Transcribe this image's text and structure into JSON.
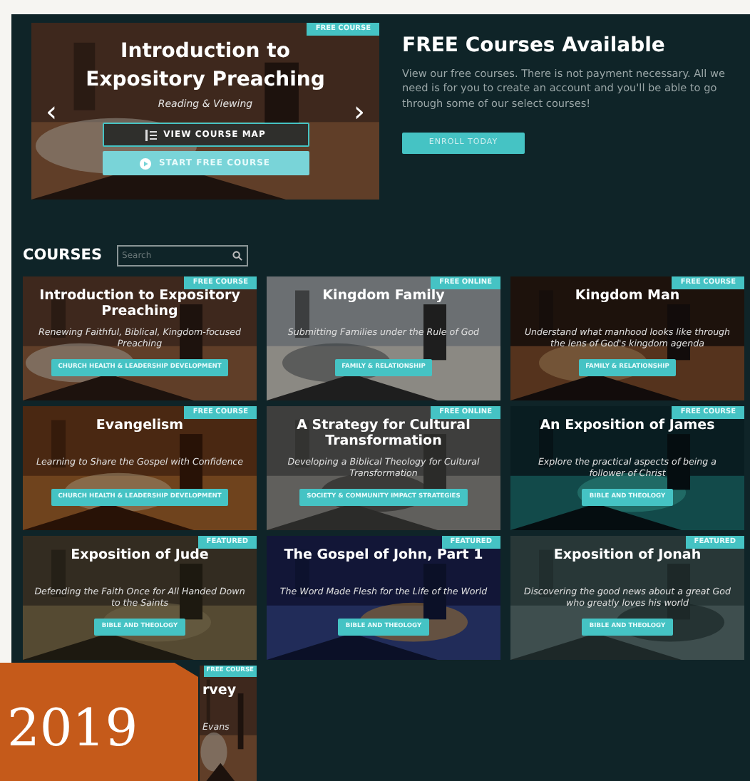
{
  "hero": {
    "badge": "FREE COURSE",
    "title": "Introduction to Expository Preaching",
    "subtitle": "Reading & Viewing",
    "prev": "‹",
    "next": "›",
    "buttons": [
      {
        "kind": "outline",
        "label": "VIEW COURSE MAP"
      },
      {
        "kind": "solid",
        "label": "START FREE COURSE"
      }
    ]
  },
  "promo": {
    "title": "FREE Courses Available",
    "text": "View our free courses. There is not payment necessary. All we need is for you to create an account and you'll be able to go through some of our select courses!",
    "button": "ENROLL TODAY"
  },
  "courses": {
    "heading": "COURSES",
    "search": {
      "placeholder": "Search"
    },
    "items": [
      {
        "badge": "FREE COURSE",
        "title": "Introduction to Expository Preaching",
        "subtitle": "Renewing Faithful, Biblical, Kingdom-focused Preaching",
        "category": "CHURCH HEALTH & LEADERSHIP DEVELOPMENT"
      },
      {
        "badge": "FREE ONLINE",
        "title": "Kingdom Family",
        "subtitle": "Submitting Families under the Rule of God",
        "category": "FAMILY & RELATIONSHIP"
      },
      {
        "badge": "FREE COURSE",
        "title": "Kingdom Man",
        "subtitle": "Understand what manhood looks like through the lens of God's kingdom agenda",
        "category": "FAMILY & RELATIONSHIP"
      },
      {
        "badge": "FREE COURSE",
        "title": "Evangelism",
        "subtitle": "Learning to Share the Gospel with Confidence",
        "category": "CHURCH HEALTH & LEADERSHIP DEVELOPMENT"
      },
      {
        "badge": "FREE ONLINE",
        "title": "A Strategy for Cultural Transformation",
        "subtitle": "Developing a Biblical Theology for Cultural Transformation",
        "category": "SOCIETY & COMMUNITY IMPACT STRATEGIES"
      },
      {
        "badge": "FREE COURSE",
        "title": "An Exposition of James",
        "subtitle": "Explore the practical aspects of being a follower of Christ",
        "category": "BIBLE AND THEOLOGY"
      },
      {
        "badge": "FEATURED",
        "title": "Exposition of Jude",
        "subtitle": "Defending the Faith Once for All Handed Down to the Saints",
        "category": "BIBLE AND THEOLOGY"
      },
      {
        "badge": "FEATURED",
        "title": "The Gospel of John, Part 1",
        "subtitle": "The Word Made Flesh for the Life of the World",
        "category": "BIBLE AND THEOLOGY"
      },
      {
        "badge": "FEATURED",
        "title": "Exposition of Jonah",
        "subtitle": "Discovering the good news about a great God who greatly loves his world",
        "category": "BIBLE AND THEOLOGY"
      },
      {
        "badge": "FREE COURSE",
        "title": "rvey",
        "subtitle": "Evans"
      }
    ]
  },
  "year_badge": "2019"
}
